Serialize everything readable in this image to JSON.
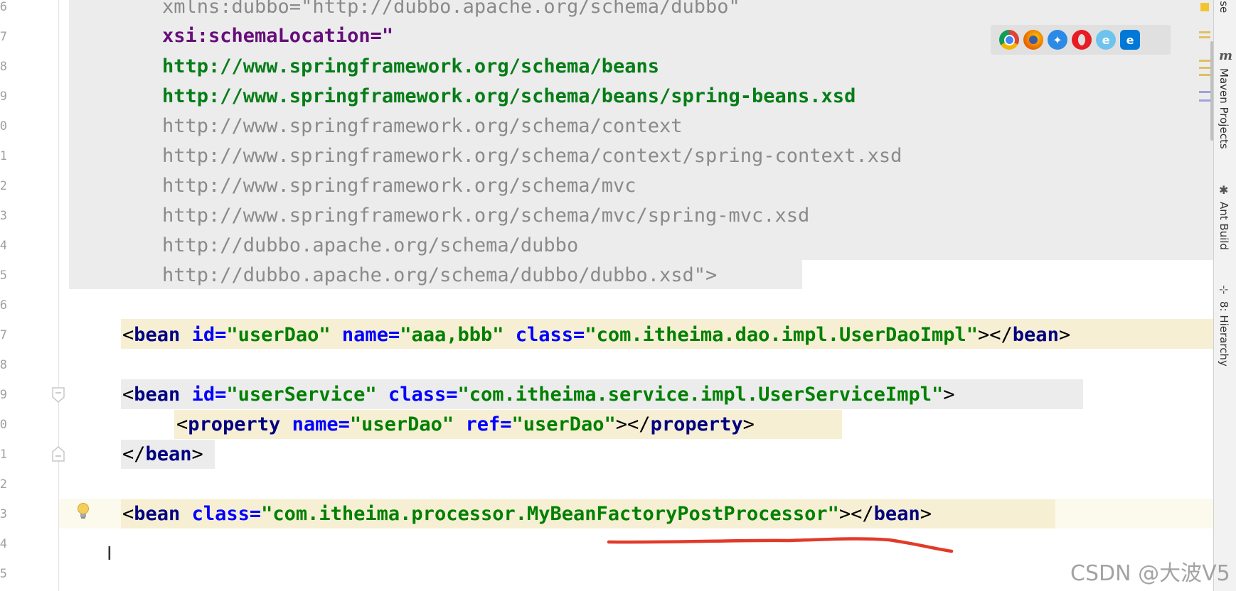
{
  "line_numbers": [
    "6",
    "7",
    "8",
    "9",
    "0",
    "1",
    "2",
    "3",
    "4",
    "5",
    "6",
    "7",
    "8",
    "9",
    "0",
    "1",
    "2",
    "3",
    "4",
    "5"
  ],
  "schema_lines": [
    "xmlns:dubbo=\"http://dubbo.apache.org/schema/dubbo\"",
    "xsi:schemaLocation=\"",
    "http://www.springframework.org/schema/beans",
    "http://www.springframework.org/schema/beans/spring-beans.xsd",
    "http://www.springframework.org/schema/context",
    "http://www.springframework.org/schema/context/spring-context.xsd",
    "http://www.springframework.org/schema/mvc",
    "http://www.springframework.org/schema/mvc/spring-mvc.xsd",
    "http://dubbo.apache.org/schema/dubbo",
    "http://dubbo.apache.org/schema/dubbo/dubbo.xsd\">"
  ],
  "bean1": {
    "open": "<",
    "tag": "bean",
    "id_attr": "id=",
    "id_val": "\"userDao\"",
    "name_attr": "name=",
    "name_val": "\"aaa,bbb\"",
    "class_attr": "class=",
    "class_val": "\"com.itheima.dao.impl.UserDaoImpl\"",
    "mid": "></",
    "close_tag": "bean",
    "end": ">"
  },
  "bean2": {
    "open": "<",
    "tag": "bean",
    "id_attr": "id=",
    "id_val": "\"userService\"",
    "class_attr": "class=",
    "class_val": "\"com.itheima.service.impl.UserServiceImpl\"",
    "end": ">"
  },
  "property": {
    "open": "<",
    "tag": "property",
    "name_attr": "name=",
    "name_val": "\"userDao\"",
    "ref_attr": "ref=",
    "ref_val": "\"userDao\"",
    "mid": "></",
    "close_tag": "property",
    "end": ">"
  },
  "bean2_close": {
    "open": "</",
    "tag": "bean",
    "end": ">"
  },
  "bean3": {
    "open": "<",
    "tag": "bean",
    "class_attr": "class=",
    "class_val": "\"com.itheima.processor.MyBeanFactoryPostProcessor\"",
    "mid": "></",
    "close_tag": "bean",
    "end": ">"
  },
  "side_tools": [
    "ase",
    "Maven Projects",
    "Ant Build",
    "8: Hierarchy"
  ],
  "watermark": "CSDN @大波V5",
  "colors": {
    "annotation": "#e23a2a",
    "schema_bg": "#ececec",
    "tag_highlight": "#f6efd4"
  }
}
